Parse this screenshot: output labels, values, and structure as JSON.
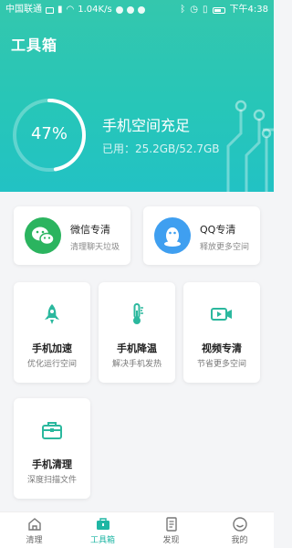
{
  "status_bar": {
    "carrier": "中国联通",
    "speed": "1.04K/s",
    "time": "下午4:38"
  },
  "header": {
    "title": "工具箱"
  },
  "storage": {
    "percent_text": "47%",
    "percent": 47,
    "status": "手机空间充足",
    "usage": "已用：25.2GB/52.7GB"
  },
  "tools": [
    {
      "title": "微信专清",
      "subtitle": "清理聊天垃圾",
      "icon": "wechat-icon",
      "color": "#2bb45f"
    },
    {
      "title": "QQ专清",
      "subtitle": "释放更多空间",
      "icon": "qq-icon",
      "color": "#3f9ff0"
    },
    {
      "title": "手机加速",
      "subtitle": "优化运行空间",
      "icon": "rocket-icon"
    },
    {
      "title": "手机降温",
      "subtitle": "解决手机发热",
      "icon": "thermometer-icon"
    },
    {
      "title": "视频专清",
      "subtitle": "节省更多空间",
      "icon": "video-icon"
    },
    {
      "title": "手机清理",
      "subtitle": "深度扫描文件",
      "icon": "toolbox-icon"
    }
  ],
  "tabbar": {
    "items": [
      {
        "label": "清理",
        "icon": "home-icon"
      },
      {
        "label": "工具箱",
        "icon": "toolbox-icon"
      },
      {
        "label": "发现",
        "icon": "document-icon"
      },
      {
        "label": "我的",
        "icon": "profile-icon"
      }
    ],
    "active": "工具箱"
  },
  "colors": {
    "accent": "#1fb6a4",
    "hero": "#2bc7b3"
  }
}
